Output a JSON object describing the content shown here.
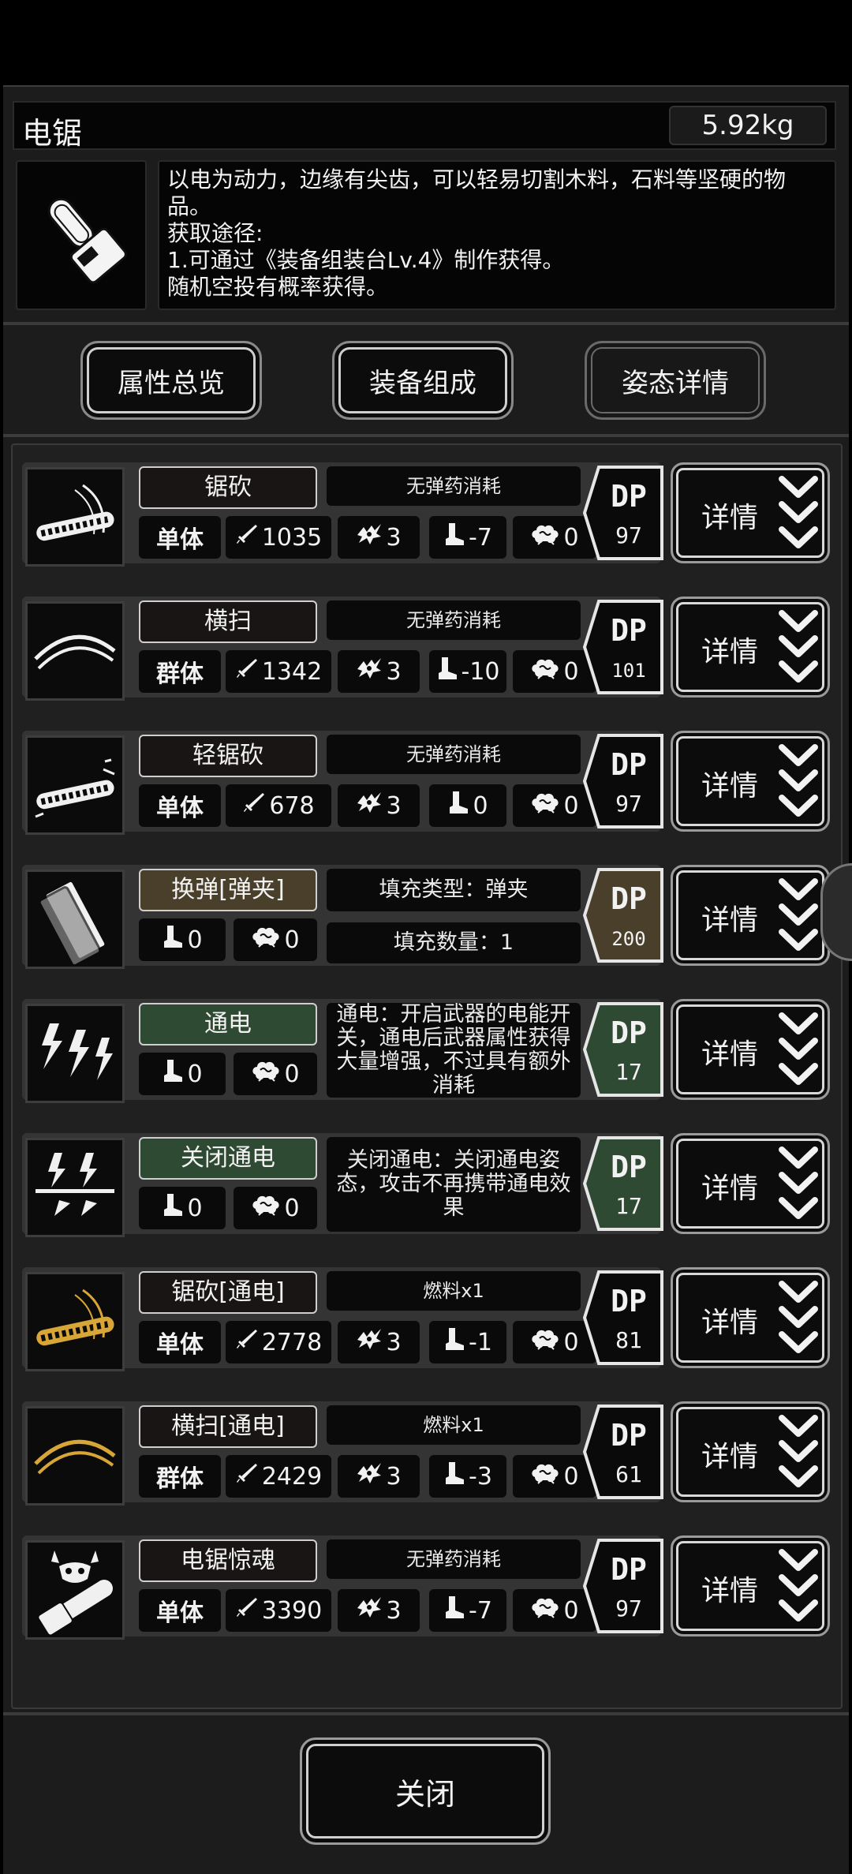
{
  "header": {
    "title": "电锯",
    "weight": "5.92kg"
  },
  "item": {
    "icon": "chainsaw-icon",
    "description_lines": [
      "以电为动力，边缘有尖齿，可以轻易切割木料，石料等坚硬的物",
      "品。",
      "获取途径:",
      "1.可通过《装备组装台Lv.4》制作获得。",
      "随机空投有概率获得。"
    ]
  },
  "top_buttons": [
    "属性总览",
    "装备组成",
    "姿态详情"
  ],
  "detail_label": "详情",
  "close_label": "关闭",
  "skills": [
    {
      "name": "锯砍",
      "kind": "attack",
      "type": "单体",
      "atk": "1035",
      "hit": "3",
      "spd": "-7",
      "sta": "0",
      "note": "无弹药消耗",
      "dp": "97",
      "icon": "saw-slash-icon"
    },
    {
      "name": "横扫",
      "kind": "attack",
      "type": "群体",
      "atk": "1342",
      "hit": "3",
      "spd": "-10",
      "sta": "0",
      "note": "无弹药消耗",
      "dp": "101",
      "icon": "sweep-slash-icon"
    },
    {
      "name": "轻锯砍",
      "kind": "attack",
      "type": "单体",
      "atk": "678",
      "hit": "3",
      "spd": "0",
      "sta": "0",
      "note": "无弹药消耗",
      "dp": "97",
      "icon": "light-saw-icon"
    },
    {
      "name": "换弹[弹夹]",
      "kind": "reload",
      "spd": "0",
      "sta": "0",
      "fill_type": "填充类型：弹夹",
      "fill_count": "填充数量：1",
      "dp": "200",
      "icon": "magazine-icon"
    },
    {
      "name": "通电",
      "kind": "power",
      "spd": "0",
      "sta": "0",
      "note": "通电：开启武器的电能开关，通电后武器属性获得大量增强，不过具有额外消耗",
      "dp": "17",
      "icon": "electric-icon"
    },
    {
      "name": "关闭通电",
      "kind": "power",
      "spd": "0",
      "sta": "0",
      "note": "关闭通电：关闭通电姿态，攻击不再携带通电效果",
      "dp": "17",
      "icon": "power-off-icon"
    },
    {
      "name": "锯砍[通电]",
      "kind": "attack",
      "type": "单体",
      "atk": "2778",
      "hit": "3",
      "spd": "-1",
      "sta": "0",
      "note": "燃料x1",
      "dp": "81",
      "icon": "saw-slash-powered-icon"
    },
    {
      "name": "横扫[通电]",
      "kind": "attack",
      "type": "群体",
      "atk": "2429",
      "hit": "3",
      "spd": "-3",
      "sta": "0",
      "note": "燃料x1",
      "dp": "61",
      "icon": "sweep-slash-powered-icon"
    },
    {
      "name": "电锯惊魂",
      "kind": "attack",
      "type": "单体",
      "atk": "3390",
      "hit": "3",
      "spd": "-7",
      "sta": "0",
      "note": "无弹药消耗",
      "dp": "97",
      "icon": "chainsaw-horror-icon"
    }
  ],
  "colors": {
    "panel": "#1c1c1c",
    "card": "#343434",
    "reload": "#4a3f2a",
    "power": "#2f4a32",
    "gold": "#d7a636"
  }
}
